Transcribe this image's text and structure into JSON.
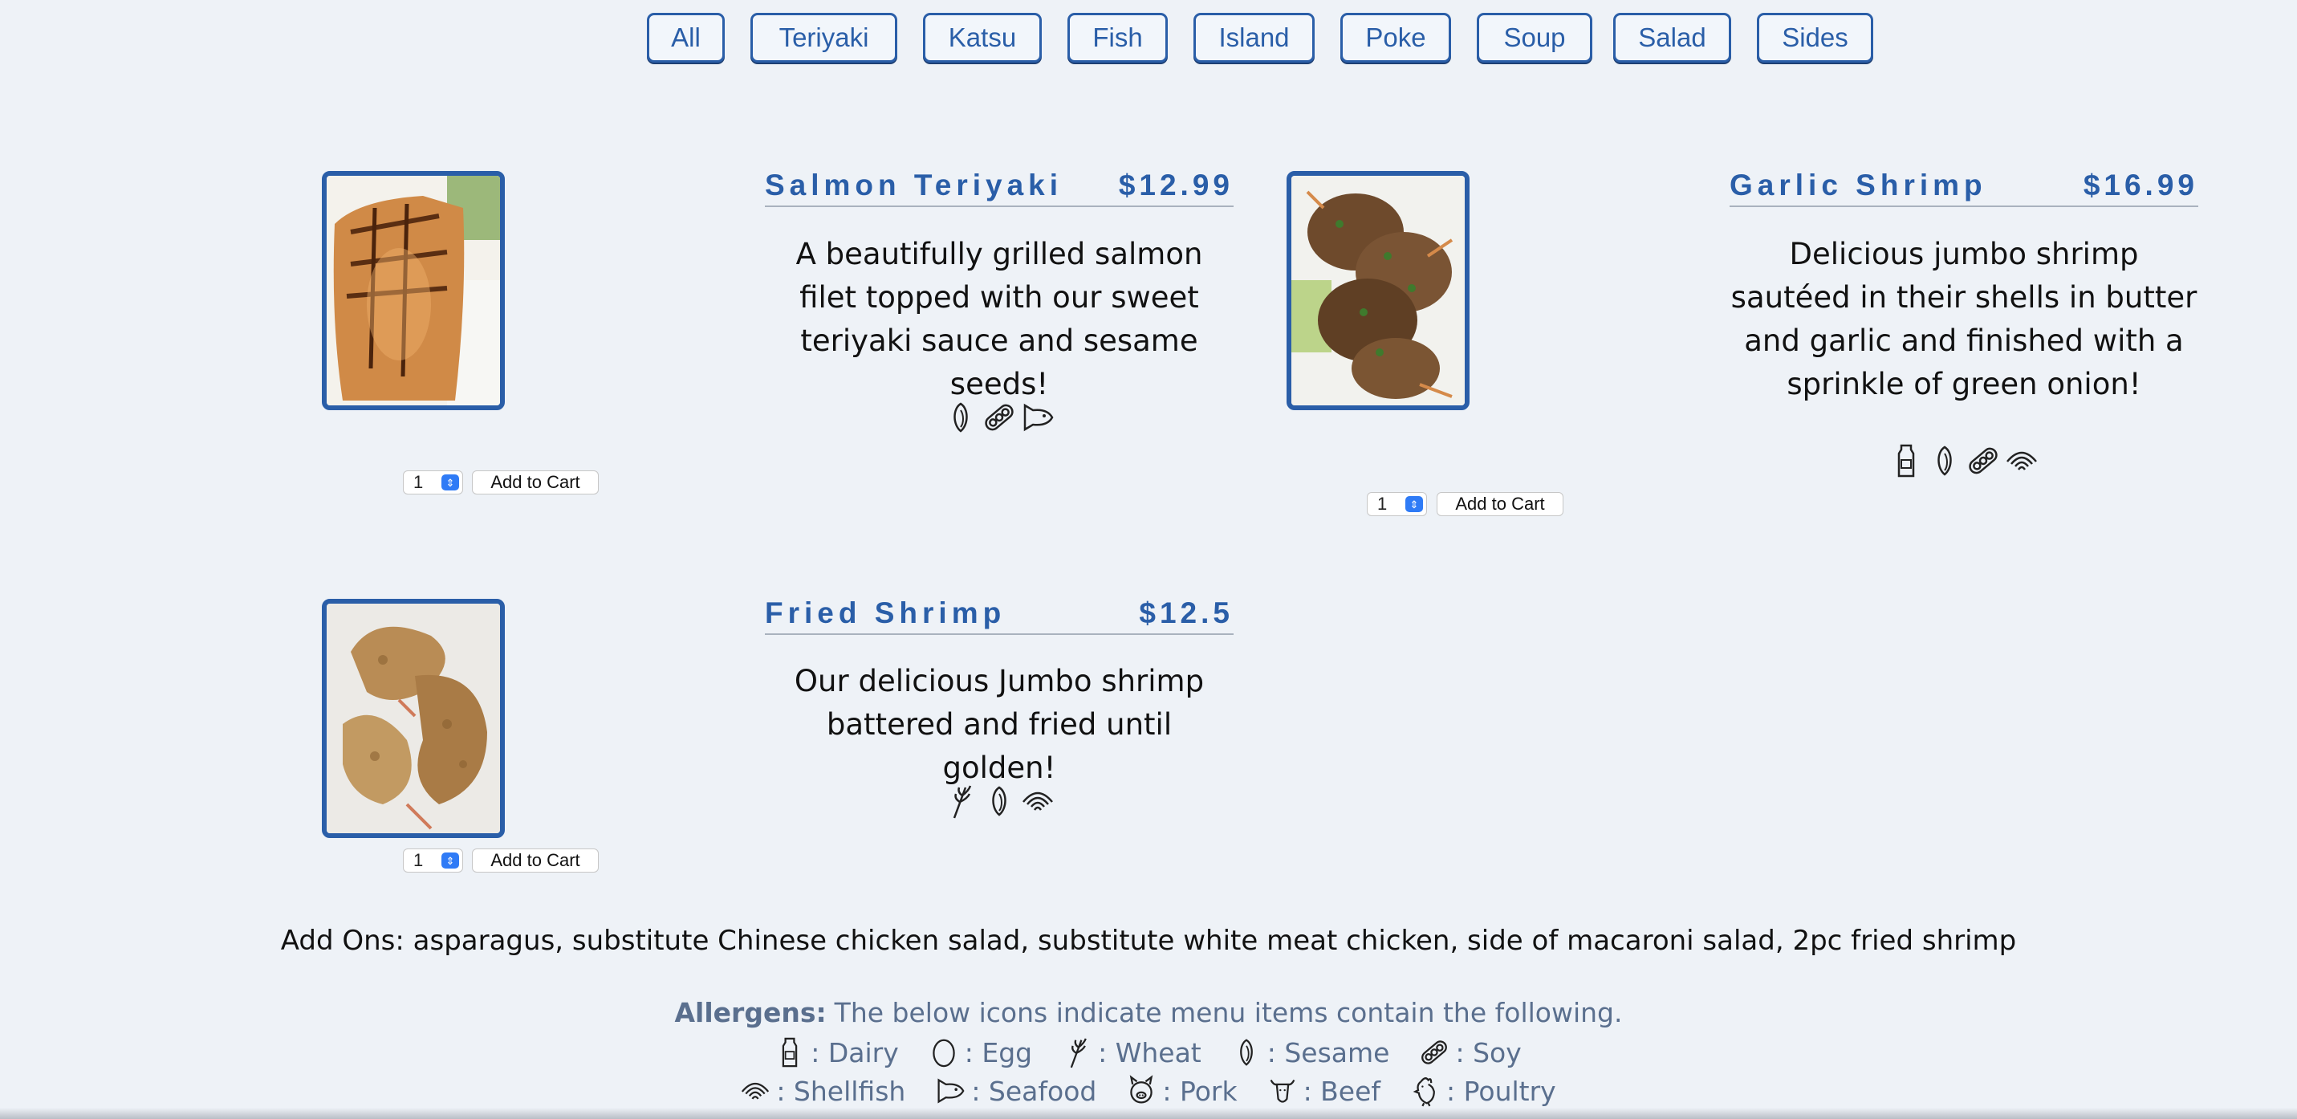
{
  "nav": {
    "categories": [
      "All",
      "Teriyaki",
      "Katsu",
      "Fish",
      "Island",
      "Poke",
      "Soup",
      "Salad",
      "Sides"
    ]
  },
  "items": [
    {
      "name": "Salmon Teriyaki",
      "price": "$12.99",
      "description": "A beautifully grilled salmon filet topped with our sweet teriyaki sauce and sesame seeds!",
      "allergens": [
        "sesame-icon",
        "soy-icon",
        "seafood-icon"
      ],
      "quantity": "1",
      "add_label": "Add to Cart"
    },
    {
      "name": "Garlic Shrimp",
      "price": "$16.99",
      "description": "Delicious jumbo shrimp sautéed in their shells in butter and garlic and finished with a sprinkle of green onion!",
      "allergens": [
        "dairy-icon",
        "sesame-icon",
        "soy-icon",
        "shellfish-icon"
      ],
      "quantity": "1",
      "add_label": "Add to Cart"
    },
    {
      "name": "Fried Shrimp",
      "price": "$12.5",
      "description": "Our delicious Jumbo shrimp battered and fried until golden!",
      "allergens": [
        "wheat-icon",
        "sesame-icon",
        "shellfish-icon"
      ],
      "quantity": "1",
      "add_label": "Add to Cart"
    }
  ],
  "addons": "Add Ons: asparagus, substitute Chinese chicken salad, substitute white meat chicken, side of macaroni salad, 2pc fried shrimp",
  "allergens": {
    "title": "Allergens:",
    "subtitle": "The below icons indicate menu items contain the following.",
    "legend_row1": [
      {
        "icon": "dairy-icon",
        "label": ": Dairy"
      },
      {
        "icon": "egg-icon",
        "label": ": Egg"
      },
      {
        "icon": "wheat-icon",
        "label": ": Wheat"
      },
      {
        "icon": "sesame-icon",
        "label": ": Sesame"
      },
      {
        "icon": "soy-icon",
        "label": ": Soy"
      }
    ],
    "legend_row2": [
      {
        "icon": "shellfish-icon",
        "label": ": Shellfish"
      },
      {
        "icon": "seafood-icon",
        "label": ": Seafood"
      },
      {
        "icon": "pork-icon",
        "label": ": Pork"
      },
      {
        "icon": "beef-icon",
        "label": ": Beef"
      },
      {
        "icon": "poultry-icon",
        "label": ": Poultry"
      }
    ]
  },
  "colors": {
    "accent": "#2a5ea8",
    "background": "#eef2f7",
    "muted_text": "#5a6f8e"
  }
}
